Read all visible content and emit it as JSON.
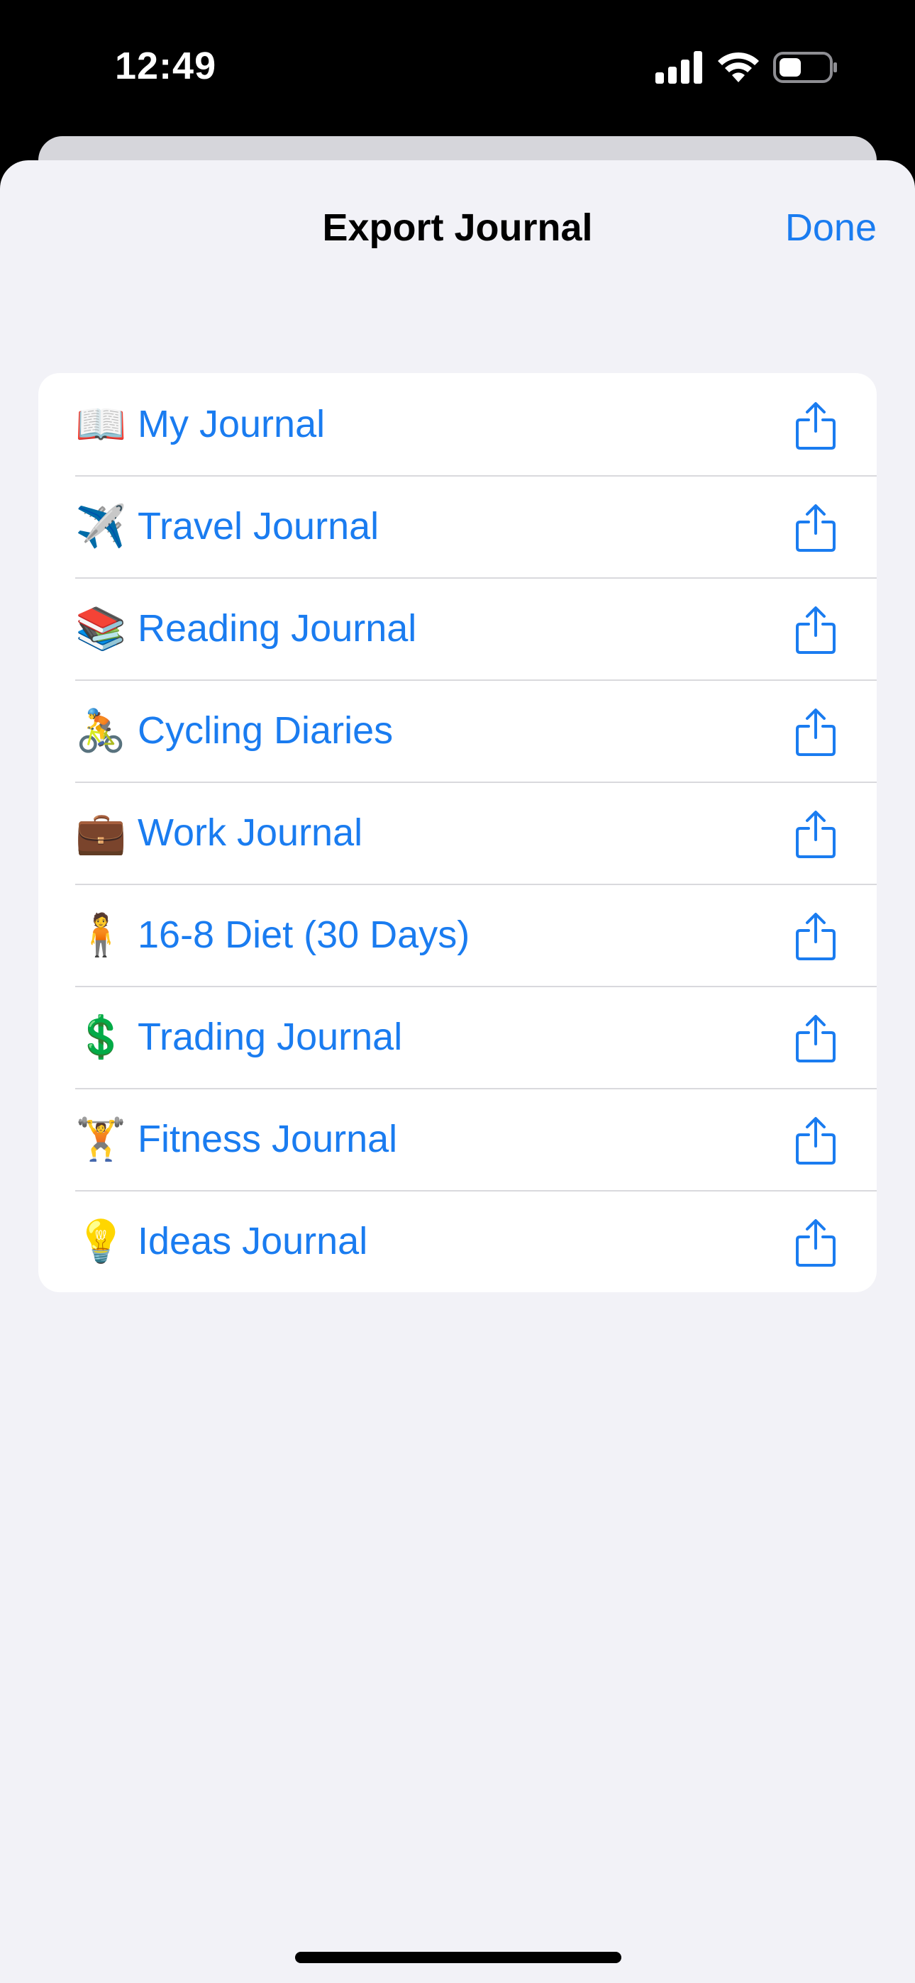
{
  "status_bar": {
    "time": "12:49",
    "icons": [
      "signal-icon",
      "wifi-icon",
      "battery-icon"
    ]
  },
  "sheet": {
    "title": "Export Journal",
    "done_label": "Done"
  },
  "journals": [
    {
      "emoji": "📖",
      "label": "My Journal"
    },
    {
      "emoji": "✈️",
      "label": "Travel Journal"
    },
    {
      "emoji": "📚",
      "label": "Reading Journal"
    },
    {
      "emoji": "🚴",
      "label": "Cycling Diaries"
    },
    {
      "emoji": "💼",
      "label": "Work Journal"
    },
    {
      "emoji": "🧍",
      "label": "16-8 Diet (30 Days)"
    },
    {
      "emoji": "💲",
      "label": "Trading Journal"
    },
    {
      "emoji": "🏋️",
      "label": "Fitness Journal"
    },
    {
      "emoji": "💡",
      "label": "Ideas Journal"
    }
  ],
  "colors": {
    "accent": "#1a7cf0",
    "sheet_background": "#f2f2f7",
    "list_background": "#ffffff",
    "separator": "#d9d9dd"
  }
}
